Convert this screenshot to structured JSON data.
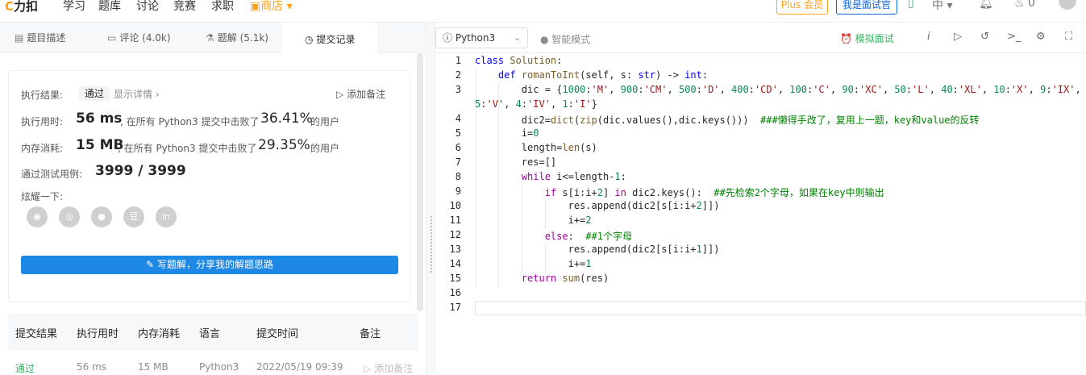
{
  "topnav": {
    "logo": "力扣",
    "items": [
      "学习",
      "题库",
      "讨论",
      "竞赛",
      "求职"
    ],
    "store": "商店",
    "plus": "Plus 会员",
    "interviewer": "我是面试官",
    "lang": "中",
    "fire_count": "0"
  },
  "tabs": [
    {
      "label": "题目描述"
    },
    {
      "label": "评论 (4.0k)"
    },
    {
      "label": "题解 (5.1k)"
    },
    {
      "label": "提交记录"
    }
  ],
  "result": {
    "status_label": "执行结果:",
    "status": "通过",
    "detail": "显示详情 ›",
    "add_note": "添加备注",
    "time_label": "执行用时:",
    "time_value": "56 ms",
    "time_mid": ", 在所有 Python3 提交中击败了",
    "time_pct": "36.41%",
    "users": "的用户",
    "mem_label": "内存消耗:",
    "mem_value": "15 MB",
    "mem_mid": ", 在所有 Python3 提交中击败了",
    "mem_pct": "29.35%",
    "cases_label": "通过测试用例:",
    "cases_value": "3999 / 3999",
    "share_label": "炫耀一下:",
    "write_btn": "写题解，分享我的解题思路"
  },
  "table": {
    "headers": [
      "提交结果",
      "执行用时",
      "内存消耗",
      "语言",
      "提交时间",
      "备注"
    ],
    "row": [
      "通过",
      "56 ms",
      "15 MB",
      "Python3",
      "2022/05/19 09:39",
      "添加备注"
    ]
  },
  "editor": {
    "language": "Python3",
    "smart_mode": "智能模式",
    "mock_interview": "模拟面试",
    "line_numbers": [
      "1",
      "2",
      "3",
      "4",
      "5",
      "6",
      "7",
      "8",
      "9",
      "10",
      "11",
      "12",
      "13",
      "14",
      "15",
      "16",
      "17"
    ]
  },
  "colors": {
    "accent": "#ffa116",
    "primary": "#1e88e5",
    "success": "#2db55d"
  }
}
